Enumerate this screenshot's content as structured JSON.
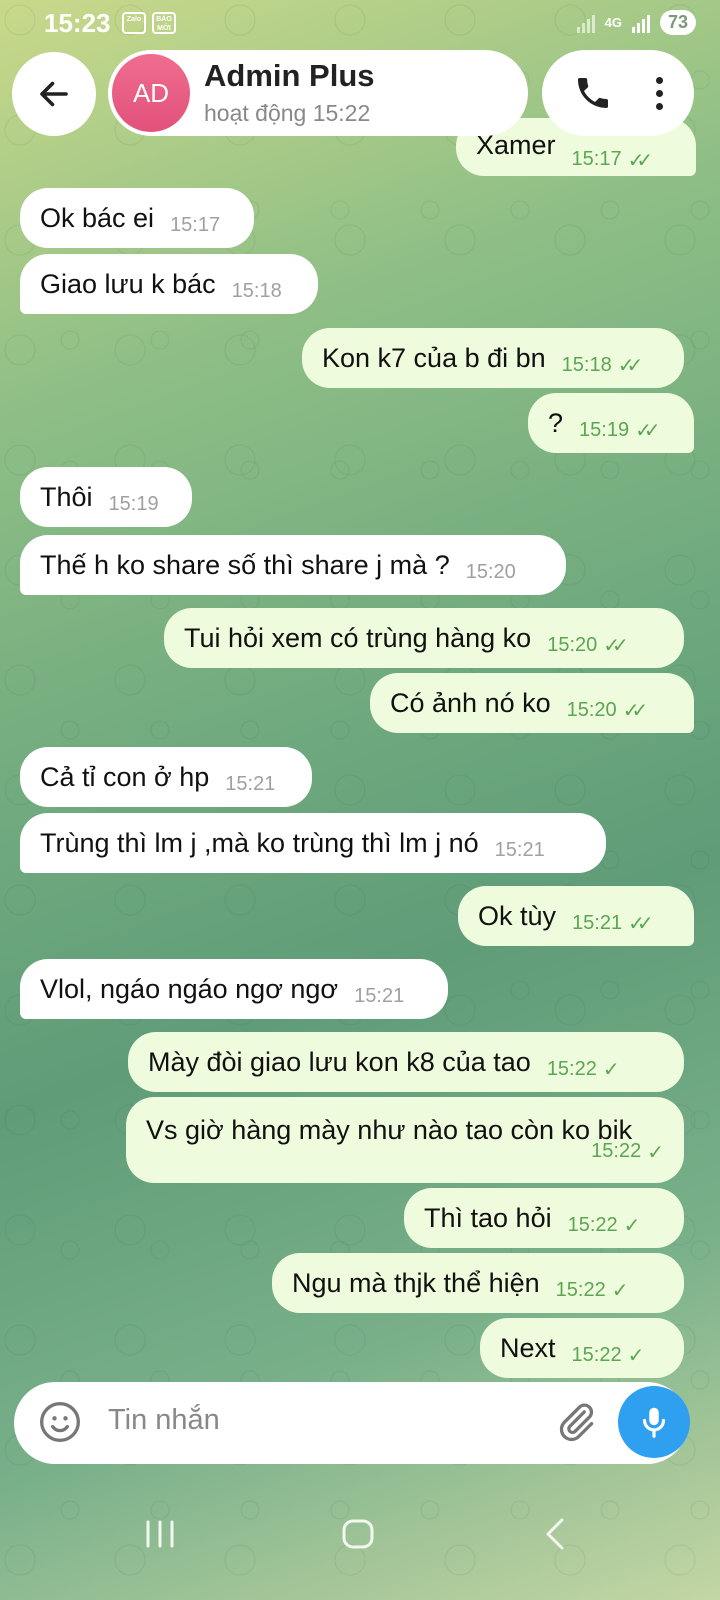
{
  "status_bar": {
    "time": "15:23",
    "app1": "Zalo",
    "app2": "BÁO MỚI",
    "network": "4G",
    "battery": "73"
  },
  "header": {
    "avatar_initials": "AD",
    "contact_name": "Admin Plus",
    "contact_status": "hoạt động 15:22"
  },
  "messages": [
    {
      "dir": "out",
      "text": "Xamer",
      "time": "15:17",
      "read": true
    },
    {
      "dir": "in",
      "text": "Ok bác ei",
      "time": "15:17"
    },
    {
      "dir": "in",
      "text": "Giao lưu k bác",
      "time": "15:18"
    },
    {
      "dir": "out",
      "text": "Kon k7 của b đi bn",
      "time": "15:18",
      "read": true
    },
    {
      "dir": "out",
      "text": "?",
      "time": "15:19",
      "read": true
    },
    {
      "dir": "in",
      "text": "Thôi",
      "time": "15:19"
    },
    {
      "dir": "in",
      "text": "Thế h ko share số thì share j mà ?",
      "time": "15:20"
    },
    {
      "dir": "out",
      "text": "Tui hỏi xem có trùng hàng ko",
      "time": "15:20",
      "read": true
    },
    {
      "dir": "out",
      "text": "Có ảnh nó ko",
      "time": "15:20",
      "read": true
    },
    {
      "dir": "in",
      "text": "Cả tỉ con ở hp",
      "time": "15:21"
    },
    {
      "dir": "in",
      "text": "Trùng thì lm j ,mà ko trùng thì lm j nó",
      "time": "15:21"
    },
    {
      "dir": "out",
      "text": "Ok tùy",
      "time": "15:21",
      "read": true
    },
    {
      "dir": "in",
      "text": "Vlol, ngáo ngáo ngơ ngơ",
      "time": "15:21"
    },
    {
      "dir": "out",
      "text": "Mày đòi giao lưu kon k8 của tao",
      "time": "15:22",
      "read": false
    },
    {
      "dir": "out",
      "text": "Vs giờ hàng mày như nào tao còn ko bik",
      "time": "15:22",
      "read": false
    },
    {
      "dir": "out",
      "text": "Thì tao hỏi",
      "time": "15:22",
      "read": false
    },
    {
      "dir": "out",
      "text": "Ngu mà thjk thể hiện",
      "time": "15:22",
      "read": false
    },
    {
      "dir": "out",
      "text": "Next",
      "time": "15:22",
      "read": false
    }
  ],
  "composer": {
    "placeholder": "Tin nhắn"
  },
  "icons": {
    "back": "arrow-left",
    "call": "phone",
    "menu": "more-vertical",
    "emoji": "smile",
    "attach": "paperclip",
    "mic": "microphone"
  },
  "colors": {
    "incoming_bubble": "#ffffff",
    "outgoing_bubble": "#eefbdc",
    "outgoing_time": "#5ca653",
    "mic_button": "#2f9ff0",
    "avatar": "#e85a80"
  }
}
